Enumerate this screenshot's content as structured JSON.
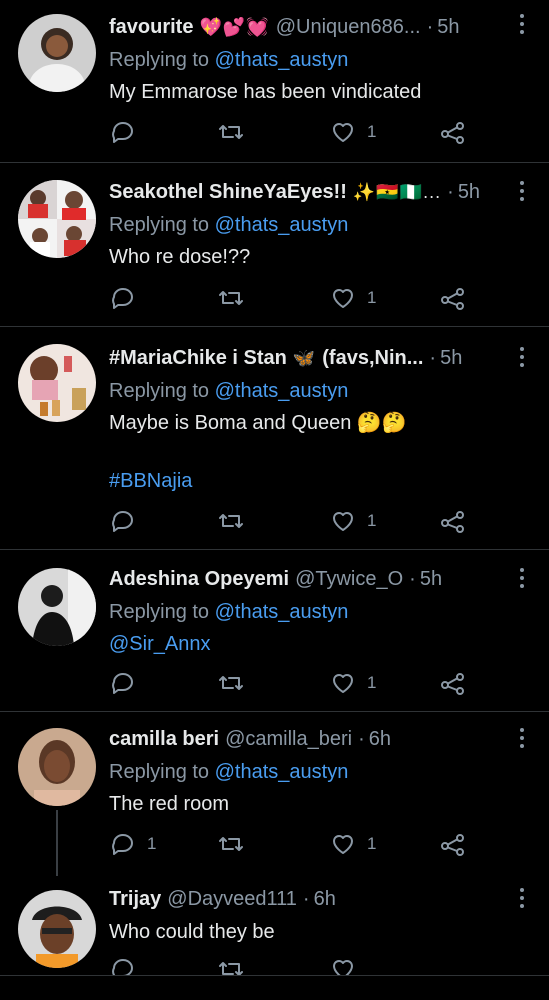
{
  "colors": {
    "background": "#000000",
    "text": "#e7e9ea",
    "muted": "#8b98a5",
    "link": "#4a9df0",
    "divider": "#2f3336"
  },
  "tweets": [
    {
      "name": "favourite",
      "emoji": "💖💕💓",
      "handle": "@Uniquen686...",
      "time": "5h",
      "replying_label": "Replying to",
      "replying_to": "@thats_austyn",
      "text": "My Emmarose has been vindicated",
      "likes": "1",
      "avatar_icon": "user-avatar"
    },
    {
      "name": "Seakothel ShineYaEyes!!",
      "emoji": "✨🇬🇭🇳🇬...",
      "handle": "",
      "time": "5h",
      "replying_label": "Replying to",
      "replying_to": "@thats_austyn",
      "text": "Who re dose!??",
      "likes": "1",
      "avatar_icon": "user-avatar"
    },
    {
      "name": "#MariaChike i Stan",
      "emoji": "🦋",
      "name_suffix": "(favs,Nin...",
      "handle": "",
      "time": "5h",
      "replying_label": "Replying to",
      "replying_to": "@thats_austyn",
      "text": "Maybe is Boma and Queen 🤔🤔",
      "hashtag": "#BBNajia",
      "likes": "1",
      "avatar_icon": "user-avatar"
    },
    {
      "name": "Adeshina Opeyemi",
      "emoji": "",
      "handle": "@Tywice_O",
      "time": "5h",
      "replying_label": "Replying to",
      "replying_to": "@thats_austyn",
      "text": "@Sir_Annx",
      "likes": "1",
      "avatar_icon": "user-avatar"
    },
    {
      "name": "camilla beri",
      "emoji": "",
      "handle": "@camilla_beri",
      "time": "6h",
      "replying_label": "Replying to",
      "replying_to": "@thats_austyn",
      "text": "The red room",
      "replies": "1",
      "likes": "1",
      "avatar_icon": "user-avatar"
    },
    {
      "name": "Trijay",
      "emoji": "",
      "handle": "@Dayveed111",
      "time": "6h",
      "text": "Who could they be",
      "avatar_icon": "user-avatar"
    }
  ]
}
